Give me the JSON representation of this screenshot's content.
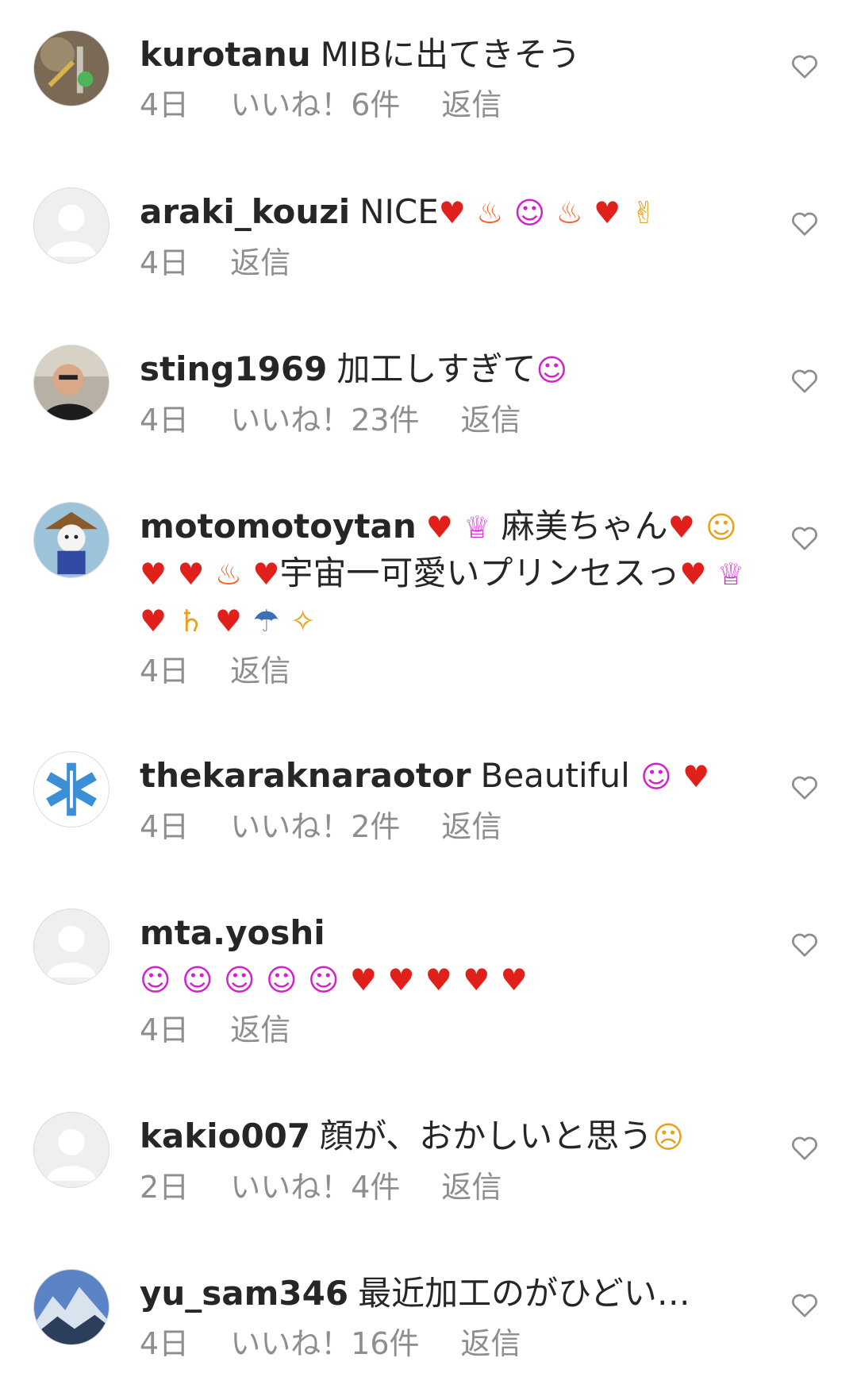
{
  "comments": [
    {
      "user": "kurotanu",
      "text": "MIBに出てきそう",
      "time": "4日",
      "likes": "いいね！6件",
      "reply": "返信"
    },
    {
      "user": "araki_kouzi",
      "text": "NICE",
      "time": "4日",
      "likes": "",
      "reply": "返信",
      "emoji": [
        "red-heart",
        "fire",
        "heart-eyes",
        "fire",
        "red-heart",
        "raising-hands"
      ]
    },
    {
      "user": "sting1969",
      "text": "加工しすぎて",
      "time": "4日",
      "likes": "いいね！23件",
      "reply": "返信",
      "emoji": [
        "kissing-face"
      ]
    },
    {
      "user": "motomotoytan",
      "text_a": "麻美ちゃん",
      "text_b": "宇宙一可愛いプリン",
      "text_c": "セスっ",
      "time": "4日",
      "likes": "",
      "reply": "返信",
      "emoji": [
        "sparkling-heart",
        "princess",
        "sparkling-heart",
        "cat-heart-eyes",
        "red-heart",
        "red-heart",
        "fire",
        "heart-with-arrow",
        "sparkling-heart",
        "princess",
        "sparkling-heart",
        "ringed-planet",
        "sparkling-heart",
        "rainbow",
        "sparkles"
      ]
    },
    {
      "user": "thekaraknaraotor",
      "text": "Beautiful",
      "time": "4日",
      "likes": "いいね！2件",
      "reply": "返信",
      "emoji": [
        "heart-eyes",
        "red-heart"
      ]
    },
    {
      "user": "mta.yoshi",
      "text": "",
      "time": "4日",
      "likes": "",
      "reply": "返信",
      "emoji": [
        "heart-eyes",
        "heart-eyes",
        "heart-eyes",
        "heart-eyes",
        "heart-eyes",
        "red-heart",
        "red-heart",
        "red-heart",
        "red-heart",
        "red-heart"
      ]
    },
    {
      "user": "kakio007",
      "text": "顔が、おかしいと思う",
      "time": "2日",
      "likes": "いいね！4件",
      "reply": "返信",
      "emoji": [
        "astonished-face"
      ]
    },
    {
      "user": "yu_sam346",
      "text": "最近加工のがひどい…",
      "time": "4日",
      "likes": "いいね！16件",
      "reply": "返信"
    }
  ],
  "emoji_glyphs": {
    "red": "♥",
    "sparkle-heart": "♥",
    "fire": "♨",
    "heart-eyes": "☺",
    "raise": "✌",
    "kiss": "☺",
    "princess": "♕",
    "cat": "☺",
    "planet": "♄",
    "rainbow": "☂",
    "sparkles": "✧",
    "wow": "☹"
  },
  "colors": {
    "username": "#262626",
    "meta": "#8e8e8e",
    "heart-red": "#e0211b",
    "emoji-pink": "#d61fd0"
  }
}
